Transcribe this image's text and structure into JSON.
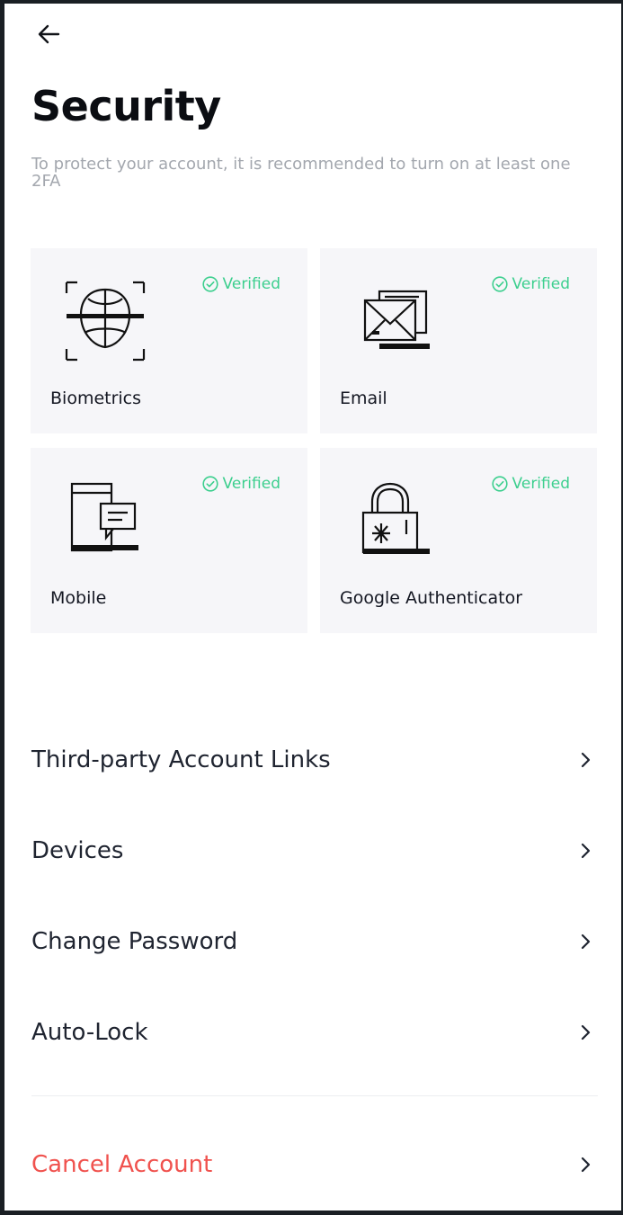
{
  "header": {
    "back_icon": "arrow-left-icon",
    "title": "Security",
    "subtitle": "To protect your account, it is recommended to turn on at least one 2FA"
  },
  "colors": {
    "verified": "#3ccf8e",
    "danger": "#f0524e",
    "card_bg": "#f6f6f9",
    "subtitle": "#a3a7ae"
  },
  "methods": [
    {
      "label": "Biometrics",
      "status": "Verified",
      "icon": "face-scan-icon"
    },
    {
      "label": "Email",
      "status": "Verified",
      "icon": "envelope-icon"
    },
    {
      "label": "Mobile",
      "status": "Verified",
      "icon": "phone-message-icon"
    },
    {
      "label": "Google Authenticator",
      "status": "Verified",
      "icon": "padlock-icon"
    }
  ],
  "menu": [
    {
      "label": "Third-party Account Links",
      "icon": "chevron-right-icon"
    },
    {
      "label": "Devices",
      "icon": "chevron-right-icon"
    },
    {
      "label": "Change Password",
      "icon": "chevron-right-icon"
    },
    {
      "label": "Auto-Lock",
      "icon": "chevron-right-icon"
    }
  ],
  "cancel": {
    "label": "Cancel Account",
    "icon": "chevron-right-icon"
  }
}
